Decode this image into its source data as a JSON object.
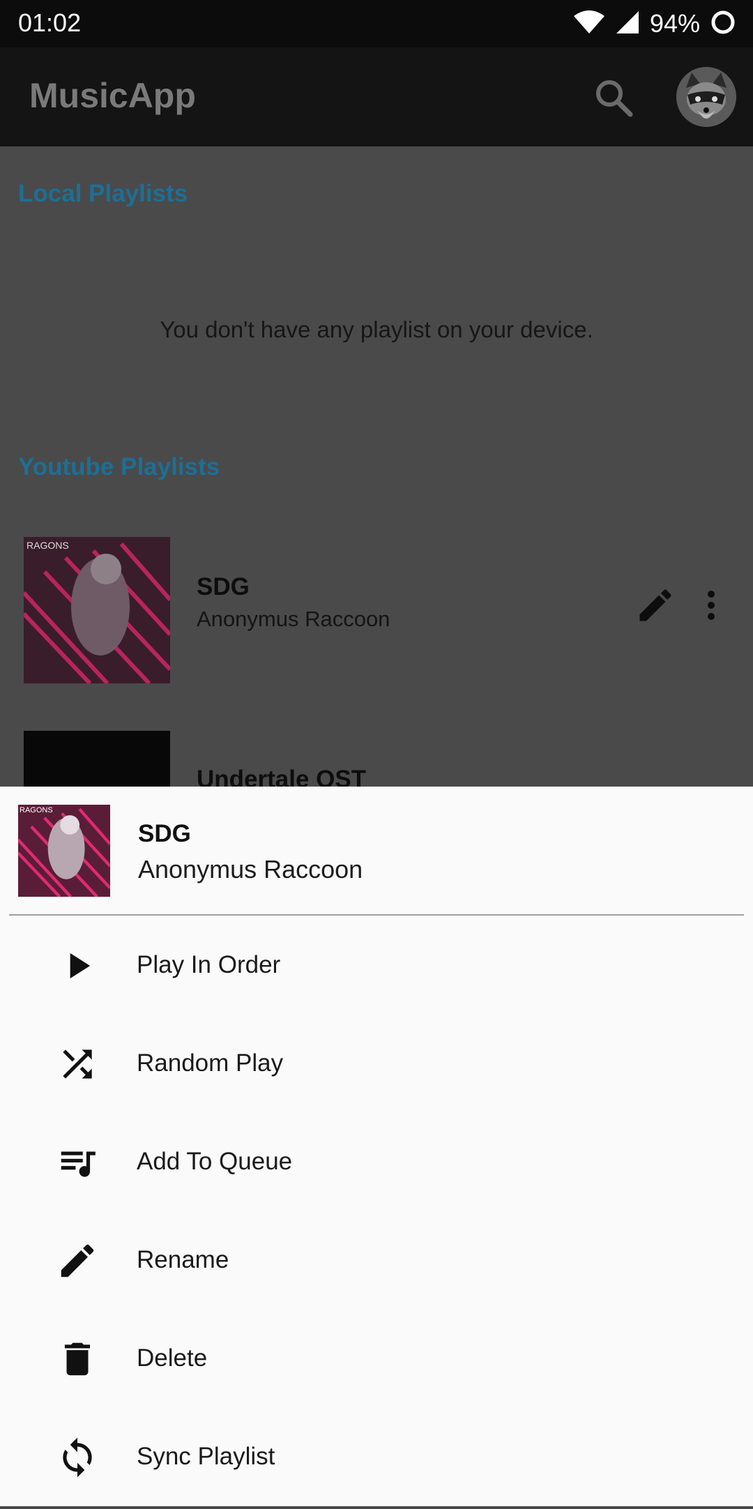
{
  "status_bar": {
    "time": "01:02",
    "battery": "94%"
  },
  "app_bar": {
    "title": "MusicApp"
  },
  "local_section": {
    "title": "Local Playlists",
    "empty_message": "You don't have any playlist on your device."
  },
  "youtube_section": {
    "title": "Youtube Playlists",
    "playlists": [
      {
        "title": "SDG",
        "owner": "Anonymus Raccoon",
        "cover_text": "RAGONS"
      },
      {
        "title": "Undertale OST",
        "owner": "",
        "cover_text": ""
      }
    ]
  },
  "sheet": {
    "title": "SDG",
    "subtitle": "Anonymus Raccoon",
    "cover_text": "RAGONS",
    "items": [
      {
        "label": "Play In Order",
        "icon": "play-icon"
      },
      {
        "label": "Random Play",
        "icon": "shuffle-icon"
      },
      {
        "label": "Add To Queue",
        "icon": "queue-music-icon"
      },
      {
        "label": "Rename",
        "icon": "pencil-icon"
      },
      {
        "label": "Delete",
        "icon": "trash-icon"
      },
      {
        "label": "Sync Playlist",
        "icon": "sync-icon"
      }
    ]
  },
  "colors": {
    "accent": "#1c6f96",
    "scrim": "#4a4a4a",
    "sheet_bg": "#fafafa",
    "appbar_bg": "#141414"
  }
}
